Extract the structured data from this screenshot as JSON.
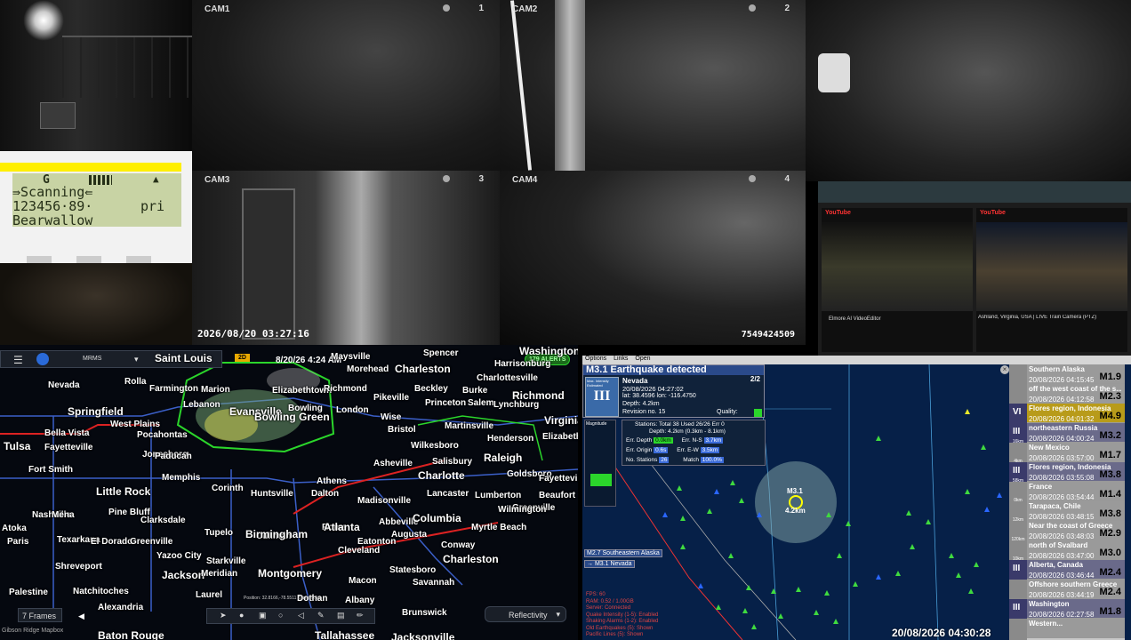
{
  "cams": {
    "cam1": {
      "label": "CAM1",
      "num": "1"
    },
    "cam2": {
      "label": "CAM2",
      "num": "2"
    },
    "cam3": {
      "label": "CAM3",
      "num": "3"
    },
    "cam4": {
      "label": "CAM4",
      "num": "4"
    },
    "timestamp": "2026/08/20 03:27:16",
    "counter": "7549424509"
  },
  "scanner": {
    "mode": "G",
    "status": "⇛Scanning⇚",
    "freq": "123456·89·",
    "priority": "pri",
    "name": "Bearwallow"
  },
  "weather": {
    "radar_product": "MRMS",
    "mode_badge": "2D",
    "datetime": "8/20/26 4:24 AM",
    "alerts": "179 ALERTS",
    "frames": "7 Frames",
    "layer": "Reflectivity",
    "position": "Position: 32.8166,-78.5511 Zoom: 5.54",
    "brand": "Gibson Ridge Mapbox",
    "cities": [
      "Saint Louis",
      "Evansville",
      "Charleston",
      "Harrisonburg",
      "Washington",
      "Springfield",
      "Farmington",
      "Marion",
      "Elizabethtown",
      "Richmond",
      "Charlottesville",
      "Bowling Green",
      "Pikeville",
      "Beckley",
      "Princeton",
      "Salem",
      "Lynchburg",
      "Nevada",
      "Rolla",
      "Tulsa",
      "Bella Vista",
      "Fayetteville",
      "West Plains",
      "Pocahontas",
      "Jonesboro",
      "London",
      "Wise",
      "Martinsville",
      "Bristol",
      "Wilkesboro",
      "Henderson",
      "Raleigh",
      "Richmond",
      "Virginia",
      "Elizabeth",
      "Salisbury",
      "Goldsboro",
      "Fayetteville",
      "Greenville",
      "Fort Smith",
      "Little Rock",
      "Memphis",
      "Huntsville",
      "Dalton",
      "Asheville",
      "Charlotte",
      "Lancaster",
      "Lumberton",
      "Wilmington",
      "Beaufort",
      "Pine Bluff",
      "Clarksdale",
      "Tupelo",
      "Cullman",
      "Rome",
      "Abbeville",
      "Columbia",
      "Myrtle Beach",
      "Atoka",
      "Paris",
      "Texarkana",
      "El Dorado",
      "Greenville",
      "Starkville",
      "Birmingham",
      "Atlanta",
      "Augusta",
      "Conway",
      "Charleston",
      "Shreveport",
      "Yazoo City",
      "Jackson",
      "Meridian",
      "Montgomery",
      "Macon",
      "Statesboro",
      "Savannah",
      "Natchitoches",
      "Palestine",
      "Alexandria",
      "Laurel",
      "Dothan",
      "Albany",
      "Brunswick",
      "Baton Rouge",
      "Tallahassee",
      "Jacksonville",
      "Corinth",
      "Athens",
      "Madisonville",
      "Cleveland",
      "Eatonton",
      "Nashville",
      "Lebanon",
      "Morehead",
      "Maysville",
      "Spencer",
      "Mena",
      "Paducah",
      "Bowling",
      "Burke"
    ]
  },
  "quake": {
    "menu": [
      "Options",
      "Links",
      "Open"
    ],
    "title": "M3.1 Earthquake detected",
    "count": "2/2",
    "region": "Nevada",
    "datetime": "20/08/2026 04:27:02",
    "latlon": "lat: 38.4596 lon: -116.4750",
    "depth": "Depth: 4.2km",
    "revision": "Revision no. 15",
    "quality_label": "Quality:",
    "intensity_label": "Max. Intensity Estimated",
    "intensity_value": "III",
    "magnitude_label": "Magnitude",
    "stations": "Stations: Total 38 Used 26/26 Err 0",
    "depth2": "Depth: 4.2km (0.3km - 8.1km)",
    "err_depth_label": "Err. Depth",
    "err_depth": "0.0km",
    "err_ns_label": "Err. N-S",
    "err_ns": "3.7km",
    "err_origin_label": "Err. Origin",
    "err_origin": "0.6s",
    "err_ew_label": "Err. E-W",
    "err_ew": "3.5km",
    "nstations_label": "No. Stations",
    "nstations": "26",
    "match_label": "Match",
    "match": "100.0%",
    "event_mag": "M3.1",
    "event_depth": "4.2km",
    "tag1": "M2.7 Southeastern Alaska",
    "tag2": "→ M3.1 Nevada",
    "status_lines": [
      "FPS: 60",
      "RAM: 0.52 / 1.00GB",
      "Server: Connected",
      "Quake Intensity (1-5): Enabled",
      "Shaking Alarms (1-2): Enabled",
      "Old Earthquakes (5): Shown",
      "Pacific Lines (5): Shown"
    ],
    "clock": "20/08/2026 04:30:28",
    "list": [
      {
        "loc": "Southern Alaska",
        "time": "20/08/2026 04:15:45",
        "mag": "M1.9",
        "int": "",
        "dist": "",
        "color": "#9a9a9a"
      },
      {
        "loc": "off the west coast of the s...",
        "time": "20/08/2026 04:12:58",
        "mag": "M2.3",
        "int": "",
        "dist": "",
        "color": "#9a9a9a"
      },
      {
        "loc": "Flores region, Indonesia",
        "time": "20/08/2026 04:01:32",
        "mag": "M4.9",
        "int": "VI",
        "dist": "",
        "color": "#b89b1a"
      },
      {
        "loc": "northeastern Russia",
        "time": "20/08/2026 04:00:24",
        "mag": "M3.2",
        "int": "III",
        "dist": "16km",
        "color": "#6a6a8a"
      },
      {
        "loc": "New Mexico",
        "time": "20/08/2026 03:57:00",
        "mag": "M1.7",
        "int": "",
        "dist": "4km",
        "color": "#9a9a9a"
      },
      {
        "loc": "Flores region, Indonesia",
        "time": "20/08/2026 03:55:08",
        "mag": "M3.8",
        "int": "III",
        "dist": "58km",
        "color": "#6a6a8a"
      },
      {
        "loc": "France",
        "time": "20/08/2026 03:54:44",
        "mag": "M1.4",
        "int": "",
        "dist": "0km",
        "color": "#9a9a9a"
      },
      {
        "loc": "Tarapaca, Chile",
        "time": "20/08/2026 03:48:15",
        "mag": "M3.8",
        "int": "",
        "dist": "12km",
        "color": "#9a9a9a"
      },
      {
        "loc": "Near the coast of Greece",
        "time": "20/08/2026 03:48:03",
        "mag": "M2.9",
        "int": "",
        "dist": "120km",
        "color": "#9a9a9a"
      },
      {
        "loc": "north of Svalbard",
        "time": "20/08/2026 03:47:00",
        "mag": "M3.0",
        "int": "",
        "dist": "10km",
        "color": "#9a9a9a"
      },
      {
        "loc": "Alberta, Canada",
        "time": "20/08/2026 03:46:44",
        "mag": "M2.4",
        "int": "III",
        "dist": "",
        "color": "#6a6a8a"
      },
      {
        "loc": "Offshore southern Greece",
        "time": "20/08/2026 03:44:19",
        "mag": "M2.4",
        "int": "",
        "dist": "",
        "color": "#9a9a9a"
      },
      {
        "loc": "Washington",
        "time": "20/08/2026 02:27:58",
        "mag": "M1.8",
        "int": "III",
        "dist": "",
        "color": "#6a6a8a"
      },
      {
        "loc": "Western...",
        "time": "",
        "mag": "",
        "int": "",
        "dist": "",
        "color": "#9a9a9a"
      }
    ]
  },
  "youtube": {
    "left_title": "Elmore AI VideoEditor",
    "right_title": "Ashland, Virginia, USA | LIVE Train Camera (PTZ)",
    "brand": "YouTube"
  },
  "colors": {
    "alert_green": "#2bd62b",
    "quake_bg": "#062048",
    "lcd_bg": "#c8d3a4",
    "scanner_bar": "#ffef00"
  }
}
